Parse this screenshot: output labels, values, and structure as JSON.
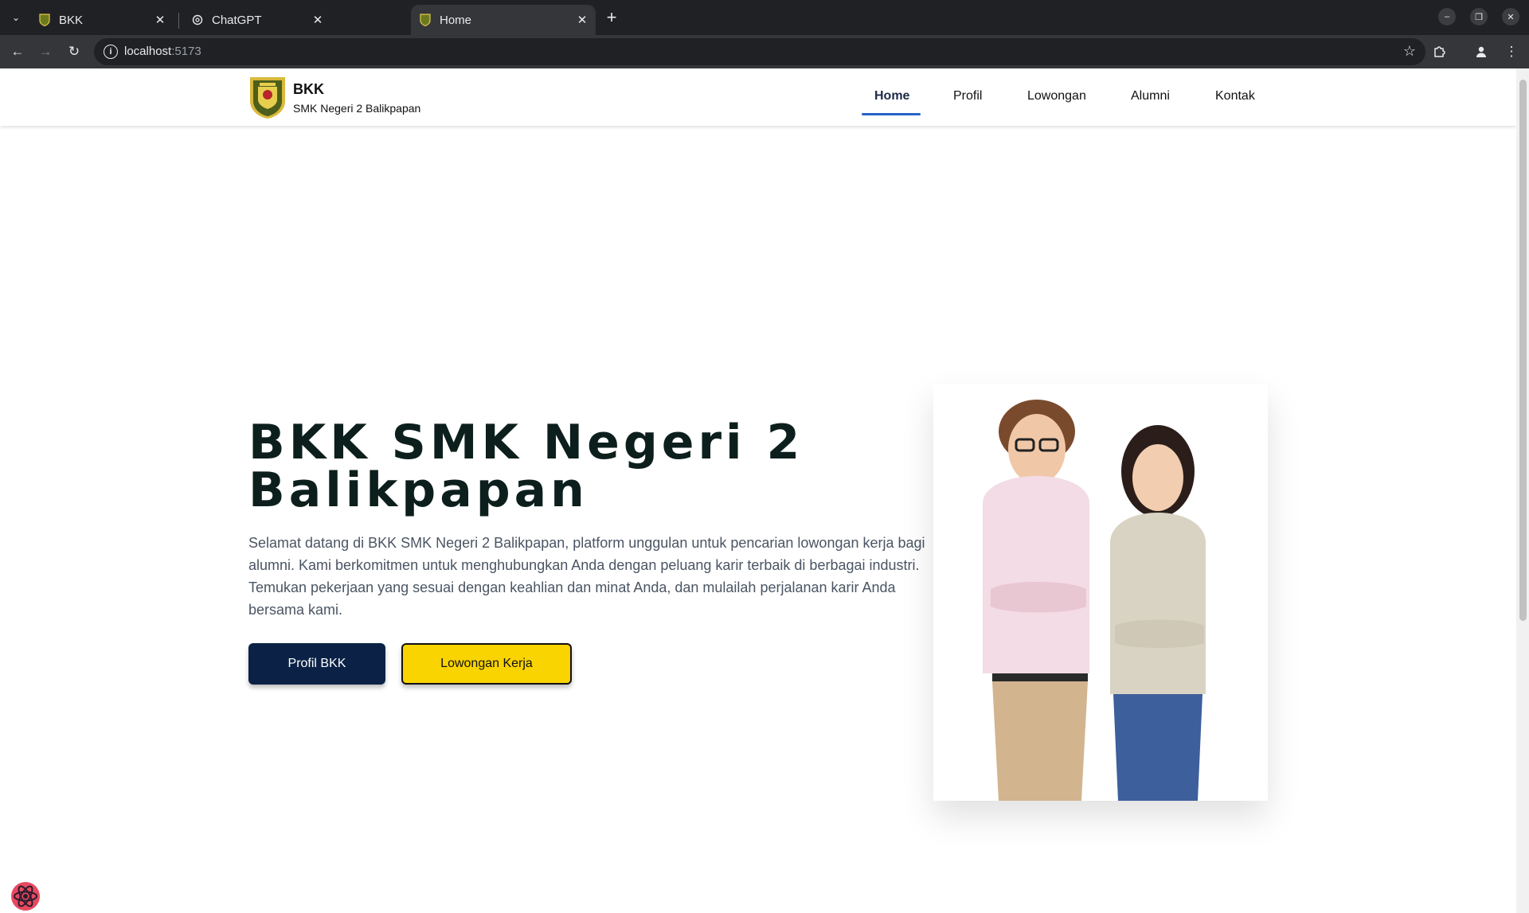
{
  "browser": {
    "tabs": [
      {
        "title": "BKK",
        "active": false
      },
      {
        "title": "ChatGPT",
        "active": false
      },
      {
        "title": "Home",
        "active": true
      }
    ],
    "url_host": "localhost",
    "url_port": ":5173"
  },
  "navbar": {
    "brand_title": "BKK",
    "brand_subtitle": "SMK Negeri 2 Balikpapan",
    "items": [
      {
        "label": "Home",
        "active": true
      },
      {
        "label": "Profil",
        "active": false
      },
      {
        "label": "Lowongan",
        "active": false
      },
      {
        "label": "Alumni",
        "active": false
      },
      {
        "label": "Kontak",
        "active": false
      }
    ]
  },
  "hero": {
    "title": "BKK SMK Negeri 2 Balikpapan",
    "description": "Selamat datang di BKK SMK Negeri 2 Balikpapan, platform unggulan untuk pencarian lowongan kerja bagi alumni. Kami berkomitmen untuk menghubungkan Anda dengan peluang karir terbaik di berbagai industri. Temukan pekerjaan yang sesuai dengan keahlian dan minat Anda, dan mulailah perjalanan karir Anda bersama kami.",
    "primary_button": "Profil BKK",
    "secondary_button": "Lowongan Kerja"
  },
  "colors": {
    "primary_button": "#0b2246",
    "secondary_button": "#f9d400",
    "nav_underline": "#2563c9"
  }
}
